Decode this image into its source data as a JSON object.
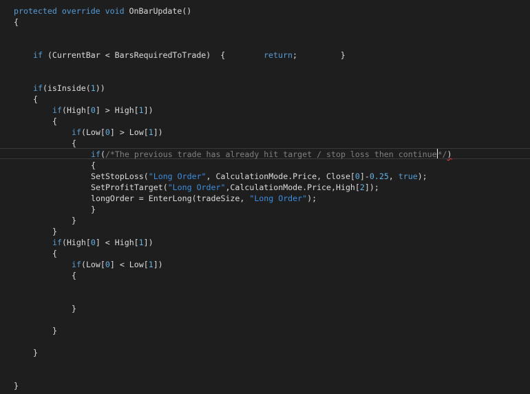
{
  "code": {
    "method_sig": {
      "kw1": "protected",
      "kw2": "override",
      "kw3": "void",
      "name": "OnBarUpdate()"
    },
    "open_brace": "{",
    "guard": {
      "kw_if": "if",
      "cond": " (CurrentBar < BarsRequiredToTrade)  {        ",
      "kw_return": "return",
      "tail": ";         }"
    },
    "inside": {
      "kw": "if",
      "pre": "(isInside(",
      "num": "1",
      "post": "))"
    },
    "brace_l2_open": "{",
    "high_gt": {
      "kw": "if",
      "a": "(High[",
      "n1": "0",
      "b": "] > High[",
      "n2": "1",
      "c": "])"
    },
    "brace_l3_open": "{",
    "low_gt": {
      "kw": "if",
      "a": "(Low[",
      "n1": "0",
      "b": "] > Low[",
      "n2": "1",
      "c": "])"
    },
    "brace_l4_open": "{",
    "trade_check": {
      "kw": "if",
      "open": "(",
      "comment": "/*The previous trade has already hit target / stop loss then continue",
      "comment_end": "*/",
      "close": ")"
    },
    "brace_l5_open": "{",
    "stop_loss": {
      "a": "SetStopLoss(",
      "s1": "\"Long Order\"",
      "b": ", CalculationMode.Price, Close[",
      "n1": "0",
      "c": "]-",
      "n2": "0.25",
      "d": ", ",
      "kw": "true",
      "e": ");"
    },
    "profit_target": {
      "a": "SetProfitTarget(",
      "s1": "\"Long Order\"",
      "b": ",CalculationMode.Price,High[",
      "n1": "2",
      "c": "]);"
    },
    "enter_long": {
      "a": "longOrder = EnterLong(tradeSize, ",
      "s1": "\"Long Order\"",
      "b": ");"
    },
    "brace_l5_close": "}",
    "brace_l4_close": "}",
    "brace_l3_close": "}",
    "high_lt": {
      "kw": "if",
      "a": "(High[",
      "n1": "0",
      "b": "] < High[",
      "n2": "1",
      "c": "])"
    },
    "brace_l3b_open": "{",
    "low_lt": {
      "kw": "if",
      "a": "(Low[",
      "n1": "0",
      "b": "] < Low[",
      "n2": "1",
      "c": "])"
    },
    "brace_l4b_open": "{",
    "brace_l4b_close": "}",
    "brace_l3b_close": "}",
    "brace_l2_close": "}",
    "close_brace": "}"
  },
  "colors": {
    "background": "#1e1e1e",
    "text": "#dcdcdc",
    "keyword": "#569cd6",
    "string": "#3b8fe0",
    "number": "#5fb6e8",
    "comment": "#808080"
  }
}
